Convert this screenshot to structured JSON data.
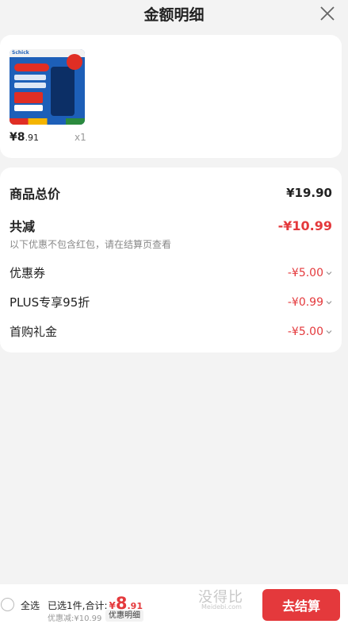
{
  "header": {
    "title": "金额明细"
  },
  "product": {
    "brand_text": "Schick",
    "price_int": "¥8",
    "price_dec": ".91",
    "quantity": "x1"
  },
  "detail": {
    "subtotal_label": "商品总价",
    "subtotal_value": "¥19.90",
    "reduction_label": "共减",
    "reduction_value": "-¥10.99",
    "note": "以下优惠不包含红包，请在结算页查看",
    "items": [
      {
        "label": "优惠券",
        "value": "-¥5.00"
      },
      {
        "label": "PLUS专享95折",
        "value": "-¥0.99"
      },
      {
        "label": "首购礼金",
        "value": "-¥5.00"
      }
    ]
  },
  "bottom_bar": {
    "select_all": "全选",
    "summary_prefix": "已选1件,合计:",
    "total_symbol": "¥",
    "total_int": "8",
    "total_dec": ".91",
    "discount_text": "优惠减:¥10.99",
    "discount_button": "优惠明细",
    "checkout": "去结算",
    "watermark": "没得比",
    "watermark_sub": "Meidebi.com"
  },
  "colors": {
    "accent": "#e4393c",
    "background": "#f3f3f3"
  }
}
